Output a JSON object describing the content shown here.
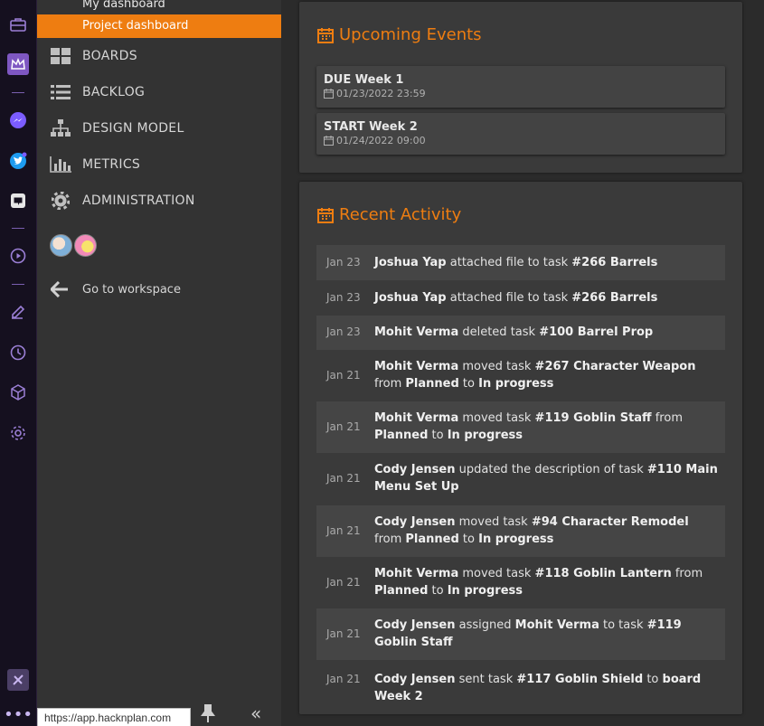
{
  "colors": {
    "accent": "#ee7d11",
    "rail_bg": "#15101f",
    "sidebar_bg": "#333333",
    "panel_bg": "#3a3a3a"
  },
  "rail": {
    "icons": [
      "briefcase-icon",
      "crown-icon",
      "messenger-icon",
      "twitter-icon",
      "discord-icon",
      "play-circle-icon",
      "edit-icon",
      "clock-icon",
      "cube-icon",
      "gear-icon",
      "hacknplan-logo-icon",
      "more-icon"
    ]
  },
  "sidebar": {
    "sub_items": [
      {
        "label": "My dashboard"
      },
      {
        "label": "Project dashboard"
      }
    ],
    "nav": [
      {
        "label": "BOARDS",
        "icon": "boards-icon"
      },
      {
        "label": "BACKLOG",
        "icon": "list-icon"
      },
      {
        "label": "DESIGN MODEL",
        "icon": "hierarchy-icon"
      },
      {
        "label": "METRICS",
        "icon": "bar-chart-icon"
      },
      {
        "label": "ADMINISTRATION",
        "icon": "gear-icon"
      }
    ],
    "goto_label": "Go to workspace",
    "status_url": "https://app.hacknplan.com"
  },
  "events": {
    "title": "Upcoming Events",
    "items": [
      {
        "title": "DUE Week 1",
        "date": "01/23/2022 23:59"
      },
      {
        "title": "START Week 2",
        "date": "01/24/2022 09:00"
      }
    ]
  },
  "activity": {
    "title": "Recent Activity",
    "items": [
      {
        "date": "Jan 23",
        "parts": [
          [
            "b",
            "Joshua Yap"
          ],
          [
            "t",
            " attached file to task "
          ],
          [
            "b",
            "#266 Barrels"
          ]
        ]
      },
      {
        "date": "Jan 23",
        "parts": [
          [
            "b",
            "Joshua Yap"
          ],
          [
            "t",
            " attached file to task "
          ],
          [
            "b",
            "#266 Barrels"
          ]
        ]
      },
      {
        "date": "Jan 23",
        "parts": [
          [
            "b",
            "Mohit Verma"
          ],
          [
            "t",
            " deleted task "
          ],
          [
            "b",
            "#100 Barrel Prop"
          ]
        ]
      },
      {
        "date": "Jan 21",
        "parts": [
          [
            "b",
            "Mohit Verma"
          ],
          [
            "t",
            " moved task "
          ],
          [
            "b",
            "#267 Character Weapon"
          ],
          [
            "t",
            " from "
          ],
          [
            "b",
            "Planned"
          ],
          [
            "t",
            " to "
          ],
          [
            "b",
            "In progress"
          ]
        ]
      },
      {
        "date": "Jan 21",
        "parts": [
          [
            "b",
            "Mohit Verma"
          ],
          [
            "t",
            " moved task "
          ],
          [
            "b",
            "#119 Goblin Staff"
          ],
          [
            "t",
            " from "
          ],
          [
            "b",
            "Planned"
          ],
          [
            "t",
            " to "
          ],
          [
            "b",
            "In progress"
          ]
        ]
      },
      {
        "date": "Jan 21",
        "parts": [
          [
            "b",
            "Cody Jensen"
          ],
          [
            "t",
            " updated the description of task "
          ],
          [
            "b",
            "#110 Main Menu Set Up"
          ]
        ]
      },
      {
        "date": "Jan 21",
        "parts": [
          [
            "b",
            "Cody Jensen"
          ],
          [
            "t",
            " moved task "
          ],
          [
            "b",
            "#94 Character Remodel"
          ],
          [
            "t",
            " from "
          ],
          [
            "b",
            "Planned"
          ],
          [
            "t",
            " to "
          ],
          [
            "b",
            "In progress"
          ]
        ]
      },
      {
        "date": "Jan 21",
        "parts": [
          [
            "b",
            "Mohit Verma"
          ],
          [
            "t",
            " moved task "
          ],
          [
            "b",
            "#118 Goblin Lantern"
          ],
          [
            "t",
            " from "
          ],
          [
            "b",
            "Planned"
          ],
          [
            "t",
            " to "
          ],
          [
            "b",
            "In progress"
          ]
        ]
      },
      {
        "date": "Jan 21",
        "parts": [
          [
            "b",
            "Cody Jensen"
          ],
          [
            "t",
            " assigned "
          ],
          [
            "b",
            "Mohit Verma"
          ],
          [
            "t",
            " to task "
          ],
          [
            "b",
            "#119 Goblin Staff"
          ]
        ]
      },
      {
        "date": "Jan 21",
        "parts": [
          [
            "b",
            "Cody Jensen"
          ],
          [
            "t",
            " sent task "
          ],
          [
            "b",
            "#117 Goblin Shield"
          ],
          [
            "t",
            " to "
          ],
          [
            "b",
            "board Week 2"
          ]
        ]
      }
    ]
  }
}
